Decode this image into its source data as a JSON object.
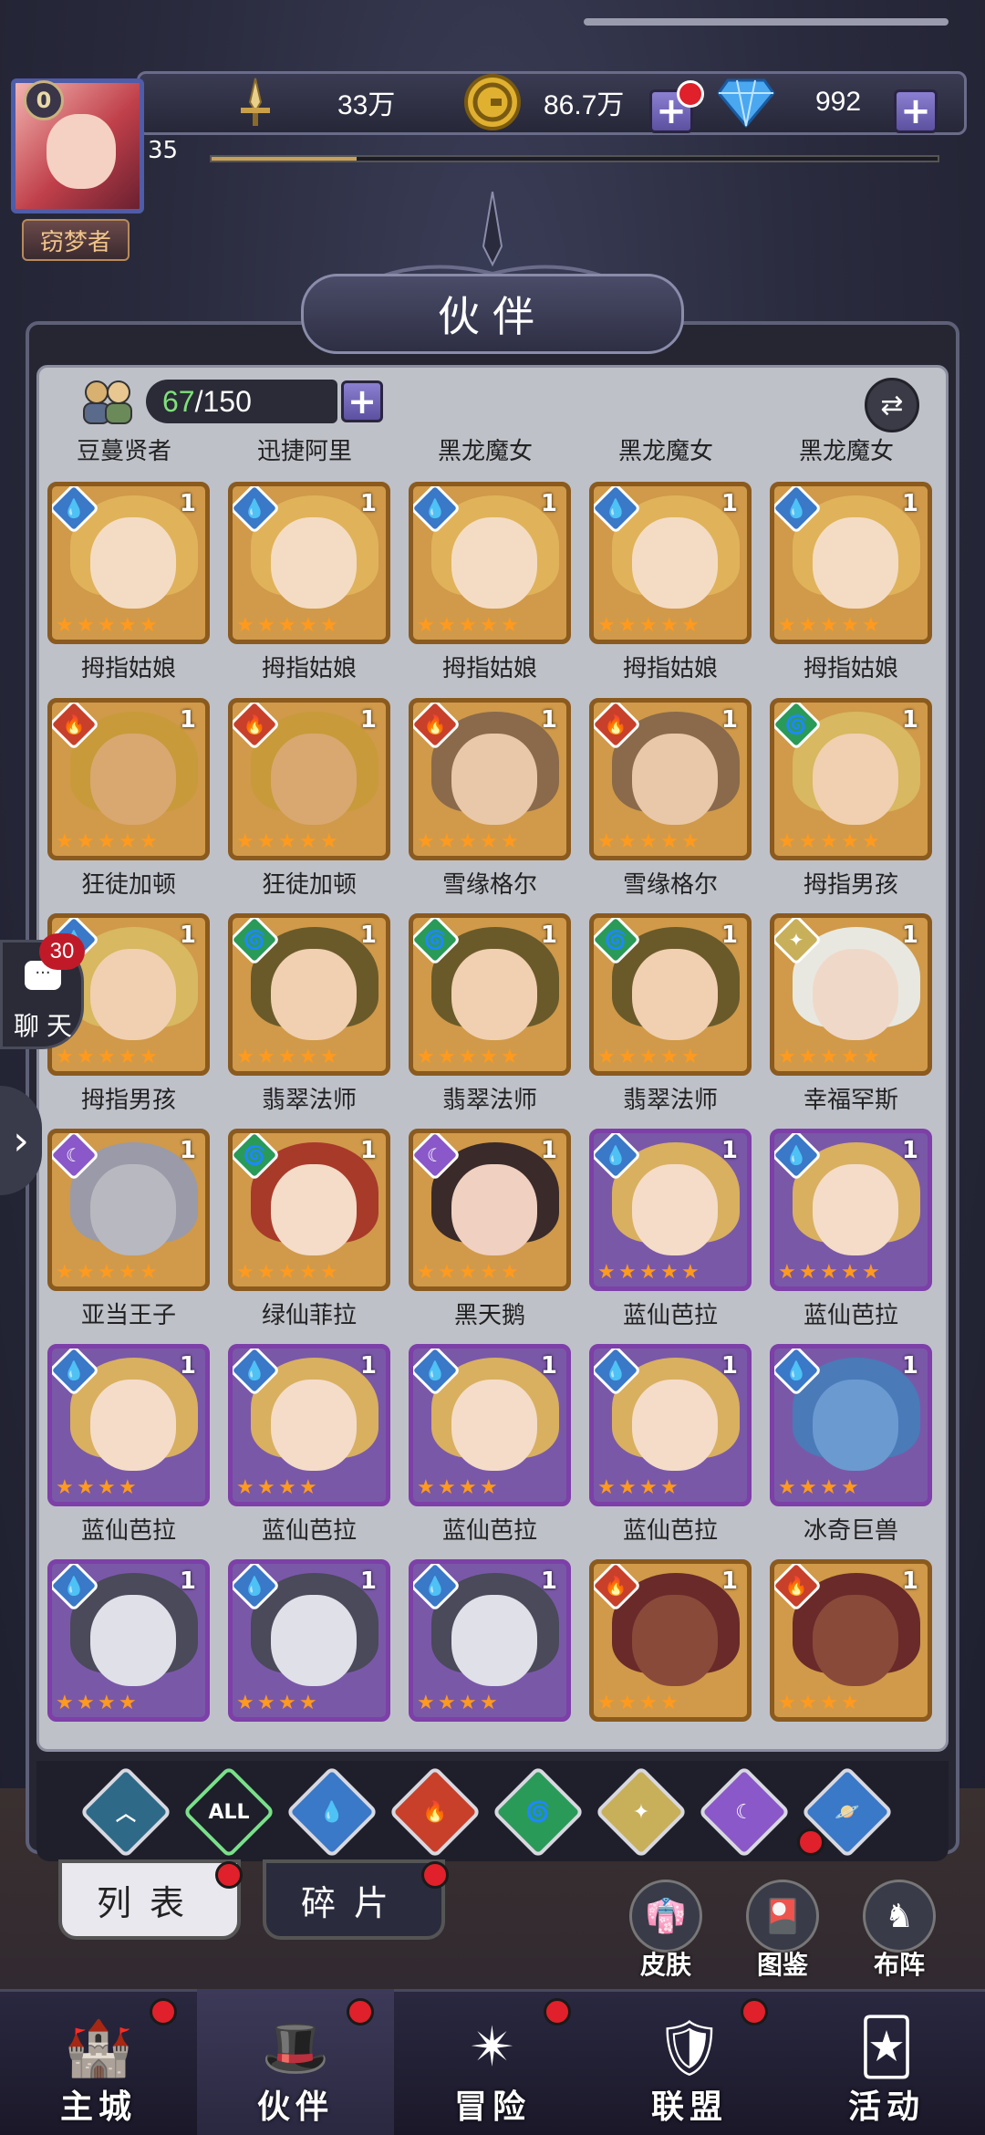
{
  "header": {
    "vip_level": "0",
    "player_level": "35",
    "xp_fraction": 0.2,
    "player_tag": "窃梦者",
    "power": "33万",
    "gold": "86.7万",
    "gems": "992",
    "plus_symbol": "+"
  },
  "page_title": "伙伴",
  "capacity": {
    "current": "67",
    "max": "/150",
    "plus": "+"
  },
  "swap_symbol": "⇄",
  "top_labels": [
    "豆蔓贤者",
    "迅捷阿里",
    "黑龙魔女",
    "黑龙魔女",
    "黑龙魔女"
  ],
  "heroes": [
    {
      "name": "拇指姑娘",
      "element": "water",
      "level": "1",
      "stars": 5,
      "frame": "gold",
      "hair": "#e0b35a",
      "skin": "#f4dcc4"
    },
    {
      "name": "拇指姑娘",
      "element": "water",
      "level": "1",
      "stars": 5,
      "frame": "gold",
      "hair": "#e0b35a",
      "skin": "#f4dcc4"
    },
    {
      "name": "拇指姑娘",
      "element": "water",
      "level": "1",
      "stars": 5,
      "frame": "gold",
      "hair": "#e0b35a",
      "skin": "#f4dcc4"
    },
    {
      "name": "拇指姑娘",
      "element": "water",
      "level": "1",
      "stars": 5,
      "frame": "gold",
      "hair": "#e0b35a",
      "skin": "#f4dcc4"
    },
    {
      "name": "拇指姑娘",
      "element": "water",
      "level": "1",
      "stars": 5,
      "frame": "gold",
      "hair": "#e0b35a",
      "skin": "#f4dcc4"
    },
    {
      "name": "狂徒加顿",
      "element": "fire",
      "level": "1",
      "stars": 5,
      "frame": "gold",
      "hair": "#c89a3a",
      "skin": "#d8a870"
    },
    {
      "name": "狂徒加顿",
      "element": "fire",
      "level": "1",
      "stars": 5,
      "frame": "gold",
      "hair": "#c89a3a",
      "skin": "#d8a870"
    },
    {
      "name": "雪缘格尔",
      "element": "fire",
      "level": "1",
      "stars": 5,
      "frame": "gold",
      "hair": "#8a6a4a",
      "skin": "#e8c8a8"
    },
    {
      "name": "雪缘格尔",
      "element": "fire",
      "level": "1",
      "stars": 5,
      "frame": "gold",
      "hair": "#8a6a4a",
      "skin": "#e8c8a8"
    },
    {
      "name": "拇指男孩",
      "element": "wind",
      "level": "1",
      "stars": 5,
      "frame": "gold",
      "hair": "#d8b860",
      "skin": "#f0d0b0"
    },
    {
      "name": "拇指男孩",
      "element": "water",
      "level": "1",
      "stars": 5,
      "frame": "gold",
      "hair": "#d8b860",
      "skin": "#f0d0b0"
    },
    {
      "name": "翡翠法师",
      "element": "wind",
      "level": "1",
      "stars": 5,
      "frame": "gold",
      "hair": "#6a5a2a",
      "skin": "#f0d0b0"
    },
    {
      "name": "翡翠法师",
      "element": "wind",
      "level": "1",
      "stars": 5,
      "frame": "gold",
      "hair": "#6a5a2a",
      "skin": "#f0d0b0"
    },
    {
      "name": "翡翠法师",
      "element": "wind",
      "level": "1",
      "stars": 5,
      "frame": "gold",
      "hair": "#6a5a2a",
      "skin": "#f0d0b0"
    },
    {
      "name": "幸福罕斯",
      "element": "light",
      "level": "1",
      "stars": 5,
      "frame": "gold",
      "hair": "#e8e8e0",
      "skin": "#f0d8c8"
    },
    {
      "name": "亚当王子",
      "element": "dark",
      "level": "1",
      "stars": 5,
      "frame": "gold",
      "hair": "#9a9aa8",
      "skin": "#b8b8c0"
    },
    {
      "name": "绿仙菲拉",
      "element": "wind",
      "level": "1",
      "stars": 5,
      "frame": "gold",
      "hair": "#a83a2a",
      "skin": "#f4dcc8"
    },
    {
      "name": "黑天鹅",
      "element": "dark",
      "level": "1",
      "stars": 5,
      "frame": "gold",
      "hair": "#3a2a2a",
      "skin": "#f0d0c0"
    },
    {
      "name": "蓝仙芭拉",
      "element": "water",
      "level": "1",
      "stars": 5,
      "frame": "purple",
      "hair": "#d8b060",
      "skin": "#f4dcc8"
    },
    {
      "name": "蓝仙芭拉",
      "element": "water",
      "level": "1",
      "stars": 5,
      "frame": "purple",
      "hair": "#d8b060",
      "skin": "#f4dcc8"
    },
    {
      "name": "蓝仙芭拉",
      "element": "water",
      "level": "1",
      "stars": 4,
      "frame": "purple",
      "hair": "#d8b060",
      "skin": "#f4dcc8"
    },
    {
      "name": "蓝仙芭拉",
      "element": "water",
      "level": "1",
      "stars": 4,
      "frame": "purple",
      "hair": "#d8b060",
      "skin": "#f4dcc8"
    },
    {
      "name": "蓝仙芭拉",
      "element": "water",
      "level": "1",
      "stars": 4,
      "frame": "purple",
      "hair": "#d8b060",
      "skin": "#f4dcc8"
    },
    {
      "name": "蓝仙芭拉",
      "element": "water",
      "level": "1",
      "stars": 4,
      "frame": "purple",
      "hair": "#d8b060",
      "skin": "#f4dcc8"
    },
    {
      "name": "冰奇巨兽",
      "element": "water",
      "level": "1",
      "stars": 4,
      "frame": "purple",
      "hair": "#4a7ab8",
      "skin": "#6a9ad0"
    },
    {
      "name": "",
      "element": "water",
      "level": "1",
      "stars": 4,
      "frame": "purple",
      "hair": "#4a4a5a",
      "skin": "#e0e0e8"
    },
    {
      "name": "",
      "element": "water",
      "level": "1",
      "stars": 4,
      "frame": "purple",
      "hair": "#4a4a5a",
      "skin": "#e0e0e8"
    },
    {
      "name": "",
      "element": "water",
      "level": "1",
      "stars": 4,
      "frame": "purple",
      "hair": "#4a4a5a",
      "skin": "#e0e0e8"
    },
    {
      "name": "",
      "element": "fire",
      "level": "1",
      "stars": 4,
      "frame": "red",
      "hair": "#6a2a2a",
      "skin": "#8a4a3a"
    },
    {
      "name": "",
      "element": "fire",
      "level": "1",
      "stars": 4,
      "frame": "red",
      "hair": "#6a2a2a",
      "skin": "#8a4a3a"
    }
  ],
  "element_glyphs": {
    "water": "💧",
    "fire": "🔥",
    "wind": "🌀",
    "light": "✦",
    "dark": "☾"
  },
  "chat": {
    "badge": "30",
    "label": "聊天",
    "bubble": "···"
  },
  "side_arrow": "›",
  "filters": [
    {
      "id": "base",
      "label": "︿"
    },
    {
      "id": "all",
      "label": "ALL"
    },
    {
      "id": "water",
      "label": "💧"
    },
    {
      "id": "fire",
      "label": "🔥"
    },
    {
      "id": "wind",
      "label": "🌀"
    },
    {
      "id": "light",
      "label": "✦"
    },
    {
      "id": "dark",
      "label": "☾"
    },
    {
      "id": "cosmic",
      "label": "🪐"
    }
  ],
  "tabs": {
    "list": "列表",
    "fragments": "碎片"
  },
  "shortcuts": {
    "skin": "皮肤",
    "gallery": "图鉴",
    "formation": "布阵"
  },
  "nav": [
    {
      "label": "主城",
      "icon": "🏰"
    },
    {
      "label": "伙伴",
      "icon": "🎩"
    },
    {
      "label": "冒险",
      "icon": "✴"
    },
    {
      "label": "联盟",
      "icon": "🛡"
    },
    {
      "label": "活动",
      "icon": "🃏"
    }
  ],
  "colors": {
    "accent_gold": "#ff9a1e",
    "badge_red": "#e0202a",
    "purple_button": "#6e62b8",
    "capacity_green": "#7fe07a"
  }
}
